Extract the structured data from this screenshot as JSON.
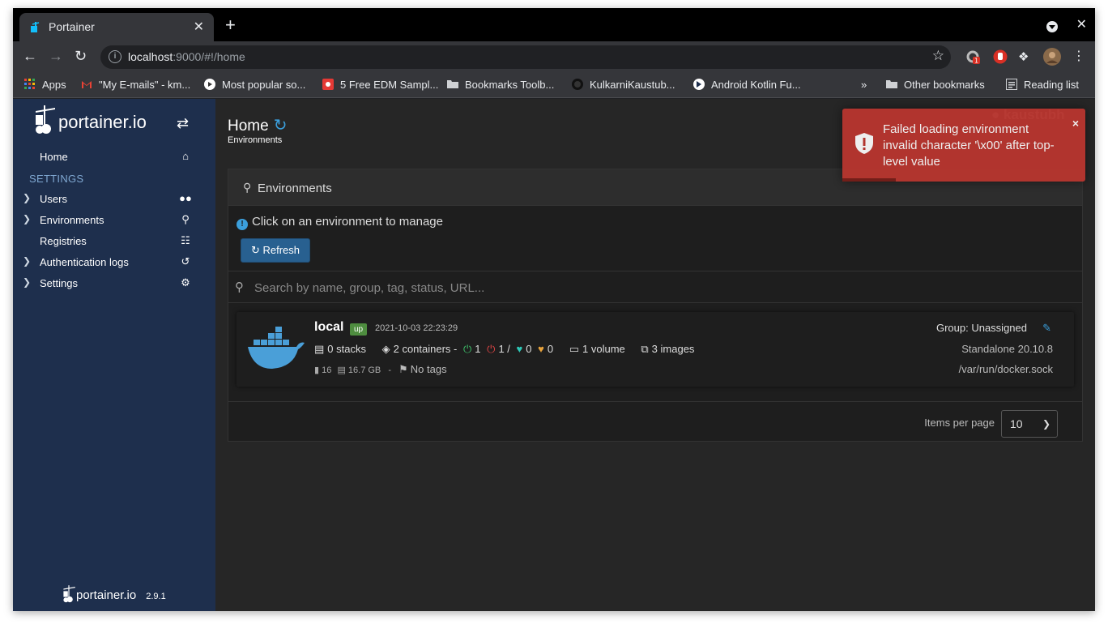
{
  "browser": {
    "tab_title": "Portainer",
    "tab_close": "✕",
    "new_tab": "+",
    "window_close": "✕",
    "url_host": "localhost",
    "url_rest": ":9000/#!/home",
    "ext_badge": "1",
    "bookmarks": [
      {
        "label": "Apps"
      },
      {
        "label": "\"My E-mails\" - km..."
      },
      {
        "label": "Most popular so..."
      },
      {
        "label": "5 Free EDM Sampl..."
      },
      {
        "label": "Bookmarks Toolb..."
      },
      {
        "label": "KulkarniKaustub..."
      },
      {
        "label": "Android Kotlin Fu..."
      }
    ],
    "overflow": "»",
    "other_bookmarks": "Other bookmarks",
    "reading_list": "Reading list"
  },
  "sidebar": {
    "logo_text": "portainer.io",
    "home": "Home",
    "settings_heading": "SETTINGS",
    "items": [
      {
        "label": "Users"
      },
      {
        "label": "Environments"
      },
      {
        "label": "Registries"
      },
      {
        "label": "Authentication logs"
      },
      {
        "label": "Settings"
      }
    ],
    "footer_logo": "portainer.io",
    "version": "2.9.1"
  },
  "header": {
    "title": "Home",
    "breadcrumb": "Environments",
    "user": "kaustubh"
  },
  "panel": {
    "title": "Environments",
    "hint": "Click on an environment to manage",
    "refresh_label": "Refresh",
    "search_placeholder": "Search by name, group, tag, status, URL..."
  },
  "environment": {
    "name": "local",
    "status": "up",
    "date": "2021-10-03 22:23:29",
    "stacks": "0 stacks",
    "containers": "2 containers -",
    "running": "1",
    "stopped": "1 /",
    "healthy": "0",
    "unhealthy": "0",
    "volumes": "1 volume",
    "images": "3 images",
    "cpu": "16",
    "memory": "16.7 GB",
    "separator": "-",
    "tags": "No tags",
    "group": "Group: Unassigned",
    "engine": "Standalone 20.10.8",
    "socket": "/var/run/docker.sock"
  },
  "pagination": {
    "label": "Items per page",
    "value": "10"
  },
  "toast": {
    "title": "Failed loading environment",
    "message": "invalid character '\\x00' after top-level value",
    "close": "×",
    "progress": 0.22
  },
  "colors": {
    "sidebar": "#1e2f4d",
    "accent": "#3b9fdc",
    "toast": "#bd362f",
    "badge_up": "#4e8d3f"
  }
}
